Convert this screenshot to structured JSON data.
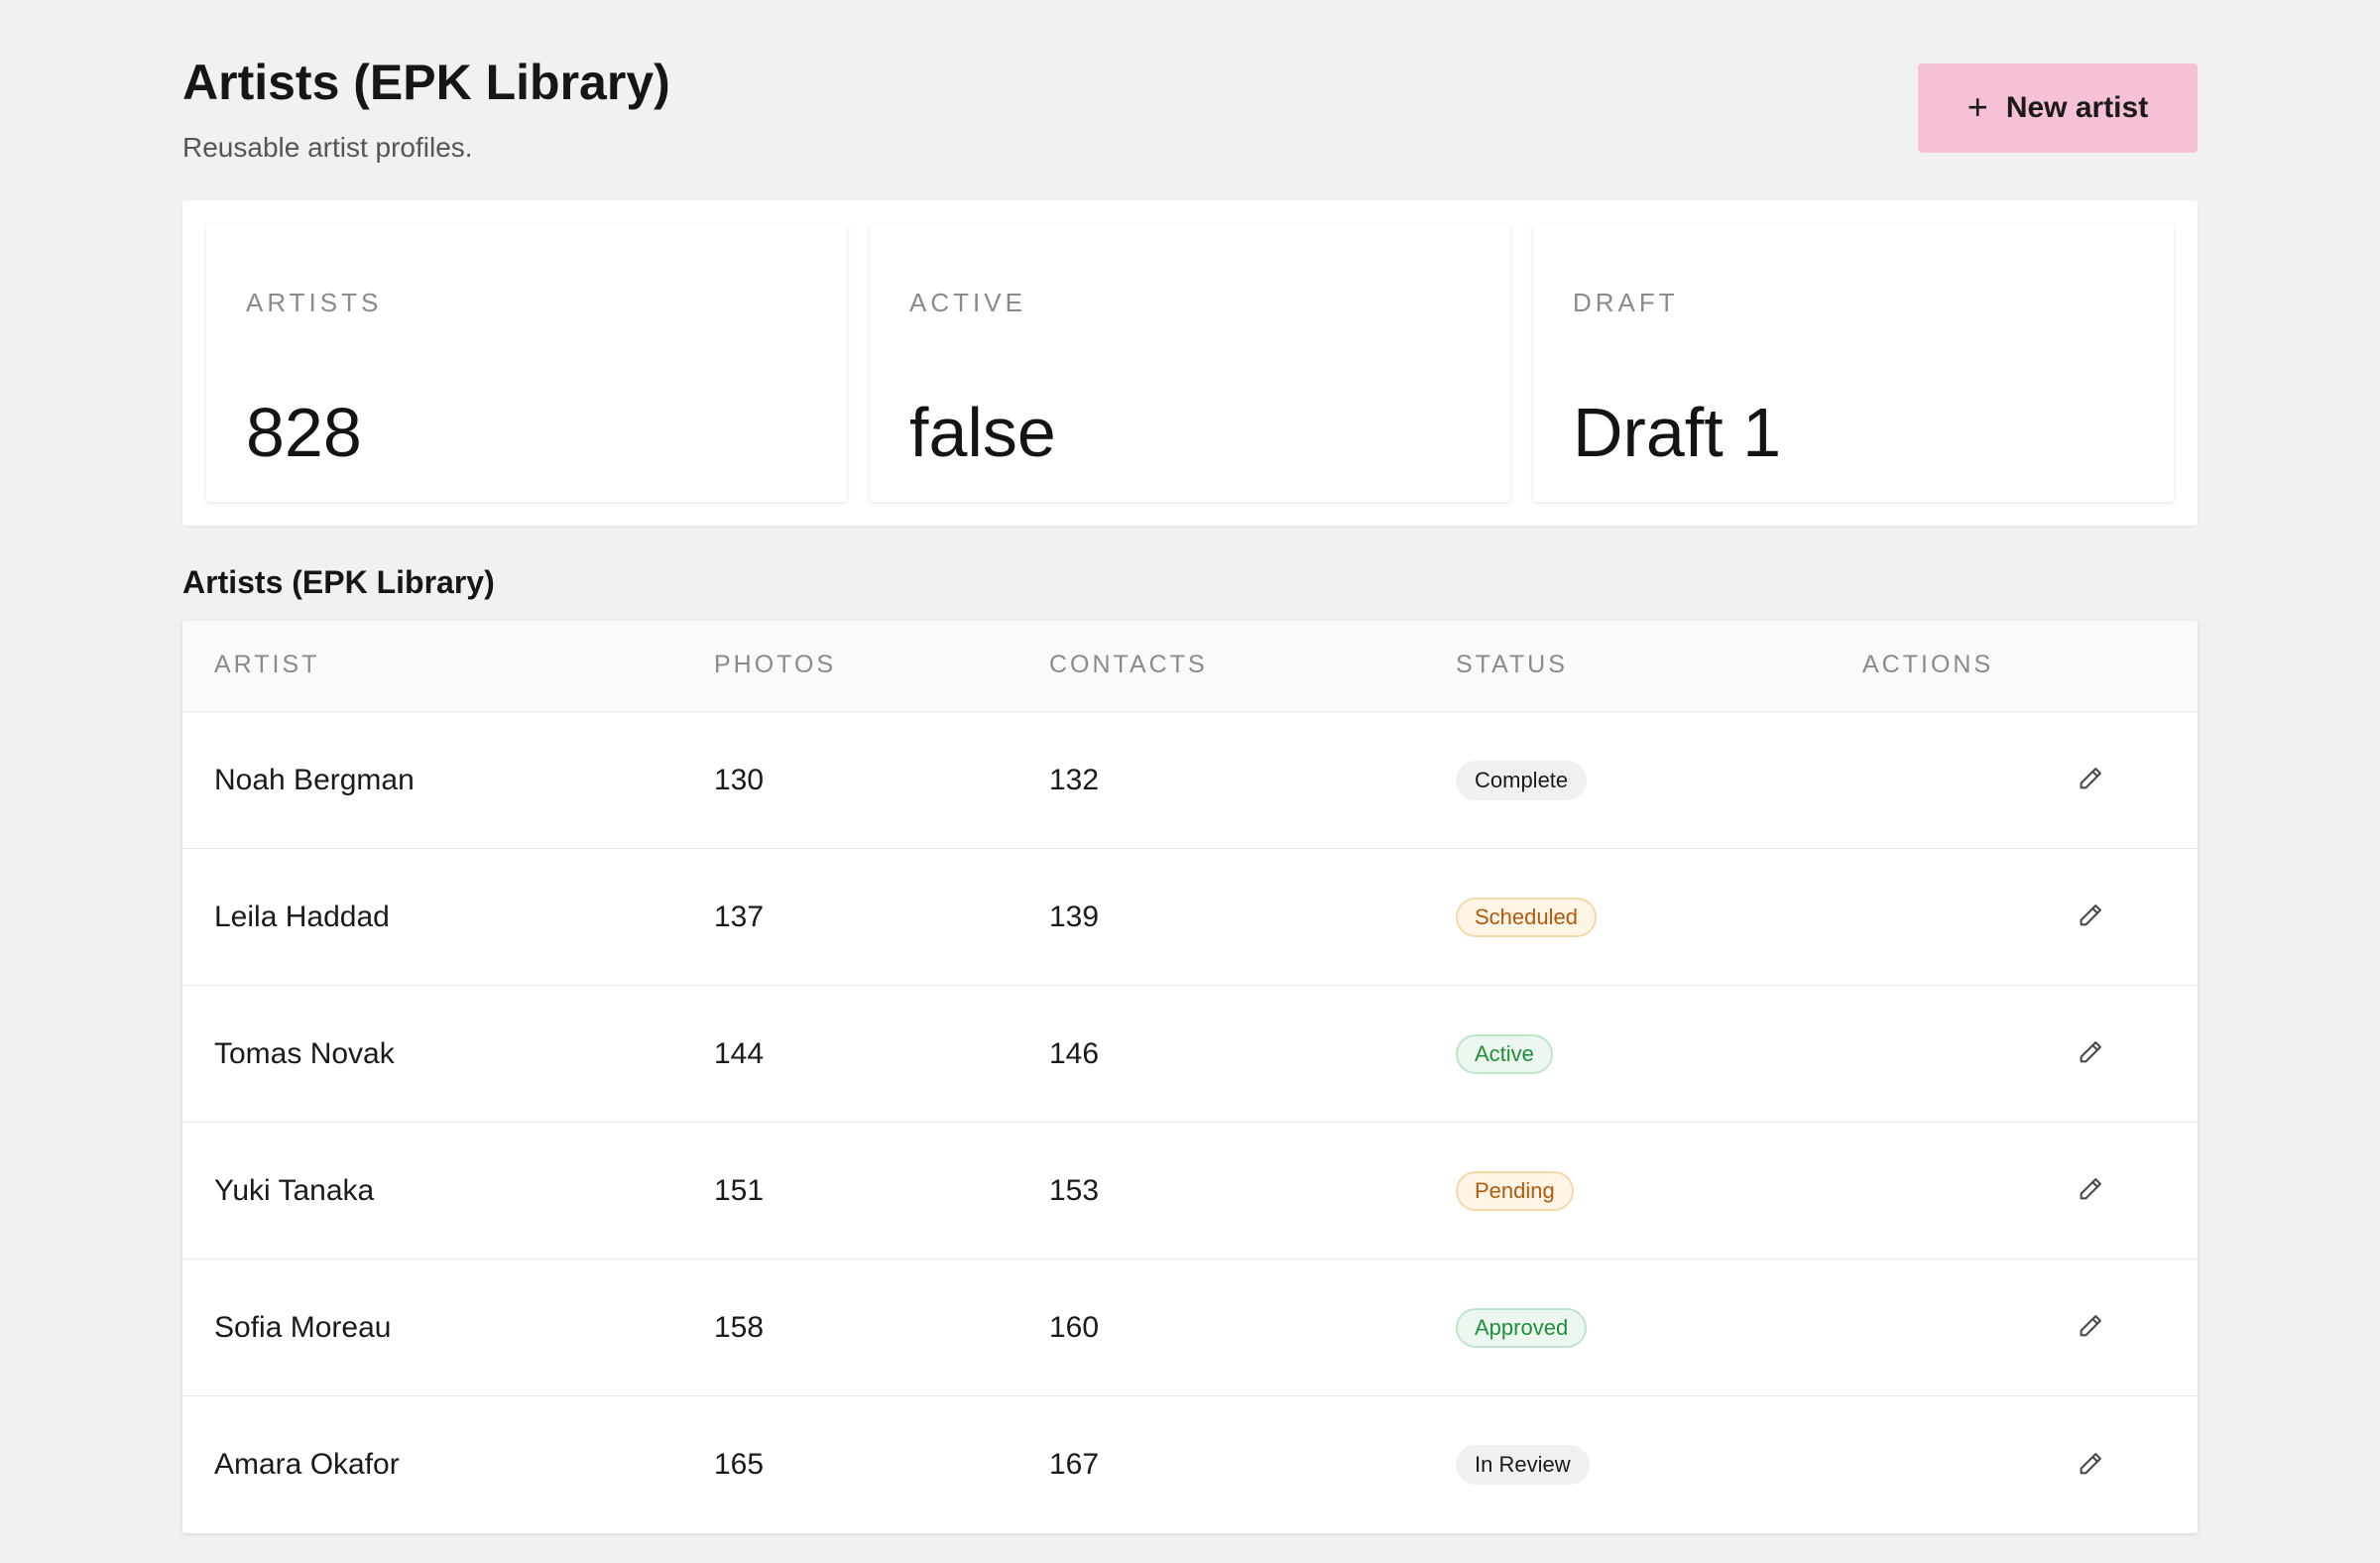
{
  "header": {
    "title": "Artists (EPK Library)",
    "subtitle": "Reusable artist profiles.",
    "new_button_label": "New artist"
  },
  "stats": [
    {
      "label": "ARTISTS",
      "value": "828"
    },
    {
      "label": "ACTIVE",
      "value": "false"
    },
    {
      "label": "DRAFT",
      "value": "Draft 1"
    }
  ],
  "table": {
    "section_title": "Artists (EPK Library)",
    "columns": [
      "ARTIST",
      "PHOTOS",
      "CONTACTS",
      "STATUS",
      "ACTIONS"
    ],
    "rows": [
      {
        "artist": "Noah Bergman",
        "photos": "130",
        "contacts": "132",
        "status": "Complete",
        "status_tone": "neutral"
      },
      {
        "artist": "Leila Haddad",
        "photos": "137",
        "contacts": "139",
        "status": "Scheduled",
        "status_tone": "warn"
      },
      {
        "artist": "Tomas Novak",
        "photos": "144",
        "contacts": "146",
        "status": "Active",
        "status_tone": "ok"
      },
      {
        "artist": "Yuki Tanaka",
        "photos": "151",
        "contacts": "153",
        "status": "Pending",
        "status_tone": "warn"
      },
      {
        "artist": "Sofia Moreau",
        "photos": "158",
        "contacts": "160",
        "status": "Approved",
        "status_tone": "ok"
      },
      {
        "artist": "Amara Okafor",
        "photos": "165",
        "contacts": "167",
        "status": "In Review",
        "status_tone": "neutral"
      }
    ]
  },
  "icons": {
    "new_button": "plus-icon",
    "row_action": "pencil-icon"
  },
  "colors": {
    "background": "#f1f1f1",
    "primary_button": "#f6c1d7",
    "status_warn": "#b3590a",
    "status_ok": "#1f8f3a"
  }
}
